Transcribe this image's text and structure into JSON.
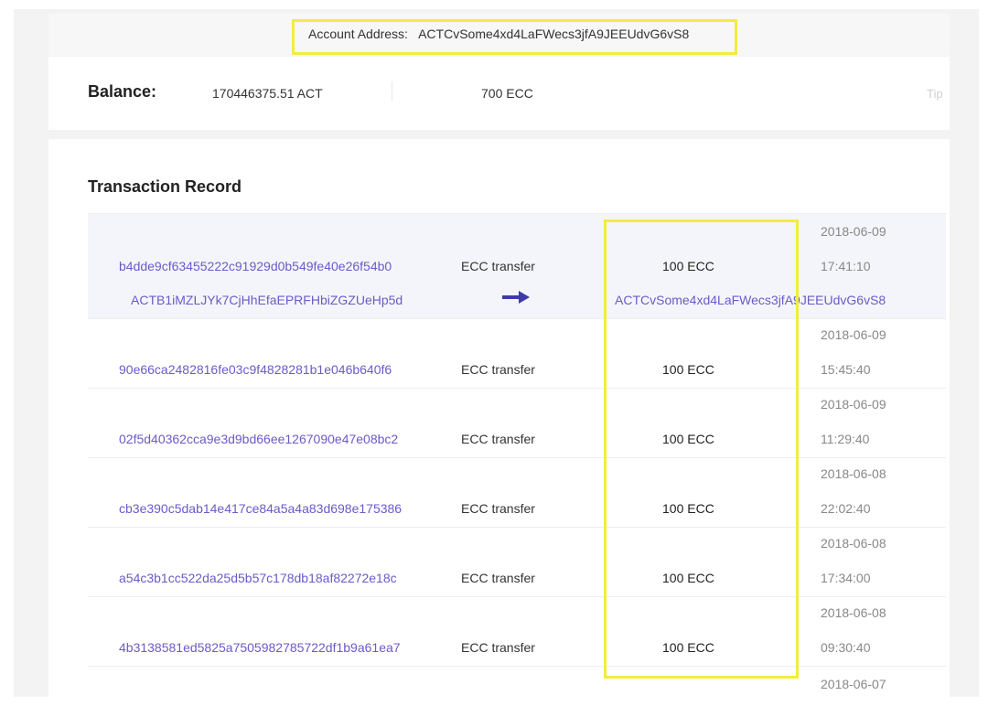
{
  "account": {
    "label": "Account Address:",
    "address": "ACTCvSome4xd4LaFWecs3jfA9JEEUdvG6vS8"
  },
  "balance": {
    "title": "Balance:",
    "act": "170446375.51 ACT",
    "ecc": "700 ECC",
    "tip": "Tip"
  },
  "transactions": {
    "title": "Transaction Record",
    "rows": [
      {
        "hash": "b4dde9cf63455222c91929d0b549fe40e26f54b0",
        "type": "ECC transfer",
        "amount": "100 ECC",
        "date": "2018-06-09",
        "time": "17:41:10",
        "from": "ACTB1iMZLJYk7CjHhEfaEPRFHbiZGZUeHp5d",
        "to": "ACTCvSome4xd4LaFWecs3jfA9JEEUdvG6vS8"
      },
      {
        "hash": "90e66ca2482816fe03c9f4828281b1e046b640f6",
        "type": "ECC transfer",
        "amount": "100 ECC",
        "date": "2018-06-09",
        "time": "15:45:40"
      },
      {
        "hash": "02f5d40362cca9e3d9bd66ee1267090e47e08bc2",
        "type": "ECC transfer",
        "amount": "100 ECC",
        "date": "2018-06-09",
        "time": "11:29:40"
      },
      {
        "hash": "cb3e390c5dab14e417ce84a5a4a83d698e175386",
        "type": "ECC transfer",
        "amount": "100 ECC",
        "date": "2018-06-08",
        "time": "22:02:40"
      },
      {
        "hash": "a54c3b1cc522da25d5b57c178db18af82272e18c",
        "type": "ECC transfer",
        "amount": "100 ECC",
        "date": "2018-06-08",
        "time": "17:34:00"
      },
      {
        "hash": "4b3138581ed5825a7505982785722df1b9a61ea7",
        "type": "ECC transfer",
        "amount": "100 ECC",
        "date": "2018-06-08",
        "time": "09:30:40"
      },
      {
        "date": "2018-06-07"
      }
    ]
  },
  "colors": {
    "highlight": "#f3ec3f",
    "link": "#6a5bc8",
    "arrow": "#3f3aa8"
  },
  "icons": {
    "transfer_arrow": "arrow-right-icon"
  }
}
